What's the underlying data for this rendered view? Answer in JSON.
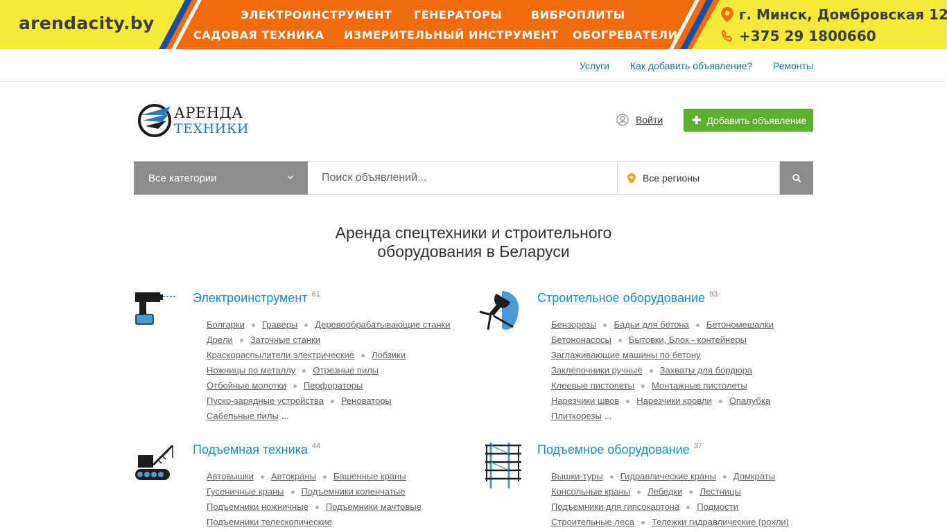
{
  "banner": {
    "brand": "arendacity.by",
    "categories": [
      "ЭЛЕКТРОИНСТРУМЕНТ",
      "ГЕНЕРАТОРЫ",
      "ВИБРОПЛИТЫ",
      "САДОВАЯ ТЕХНИКА",
      "ИЗМЕРИТЕЛЬНЫЙ ИНСТРУМЕНТ",
      "ОБОГРЕВАТЕЛИ"
    ],
    "address": "г. Минск, Домбровская 12",
    "phone": "+375 29 1800660",
    "colors": {
      "yellow": "#f5ea3a",
      "orange": "#f26a0e",
      "blue": "#1a4fa3"
    }
  },
  "top_links": [
    "Услуги",
    "Как добавить объявление?",
    "Ремонты"
  ],
  "header": {
    "logo_line1": "АРЕНДА",
    "logo_line2": "ТЕХНИКИ",
    "login_label": "Войти",
    "add_button_label": "Добавить объявление"
  },
  "search": {
    "category_value": "Все категории",
    "query_placeholder": "Поиск объявлений...",
    "region_value": "Все регионы"
  },
  "main": {
    "title_line1": "Аренда спецтехники и строительного",
    "title_line2": "оборудования в Беларуси",
    "sections": [
      {
        "name": "Электроинструмент",
        "count": "61",
        "icon": "drill-icon",
        "rows": [
          [
            "Болгарки",
            "Граверы",
            "Деревообрабатывающие станки"
          ],
          [
            "Дрели",
            "Заточные станки"
          ],
          [
            "Краскораспылители электрические",
            "Лобзики"
          ],
          [
            "Ножницы по металлу",
            "Отрезные пилы"
          ],
          [
            "Отбойные молотки",
            "Перфораторы"
          ],
          [
            "Пуско-зарядные устройства",
            "Реноваторы"
          ],
          [
            "Сабельные пилы"
          ]
        ],
        "more": "..."
      },
      {
        "name": "Строительное оборудование",
        "count": "93",
        "icon": "construction-tool-icon",
        "rows": [
          [
            "Бензорезы",
            "Бадьи для бетона",
            "Бетономешалки"
          ],
          [
            "Бетононасосы",
            "Бытовки, Блок - контейнеры"
          ],
          [
            "Заглаживающие машины по бетону"
          ],
          [
            "Заклепочники ручные",
            "Захваты для бордюра"
          ],
          [
            "Клеевые пистолеты",
            "Монтажные пистолеты"
          ],
          [
            "Нарезчики швов",
            "Нарезчики кровли",
            "Опалубка"
          ],
          [
            "Плиткорезы"
          ]
        ],
        "more": "..."
      },
      {
        "name": "Подъемная техника",
        "count": "44",
        "icon": "crawler-crane-icon",
        "rows": [
          [
            "Автовышки",
            "Автокраны",
            "Башенные краны"
          ],
          [
            "Гусеничные краны",
            "Подъемники коленчатые"
          ],
          [
            "Подъемники ножничные",
            "Подъемники мачтовые"
          ],
          [
            "Подъемники телескопические"
          ]
        ],
        "more": ""
      },
      {
        "name": "Подъемное оборудование",
        "count": "37",
        "icon": "scaffold-tower-icon",
        "rows": [
          [
            "Вышки-туры",
            "Гидравлические краны",
            "Домкраты"
          ],
          [
            "Консольные краны",
            "Лебедки",
            "Лестницы"
          ],
          [
            "Подъемники для гипсокартона",
            "Подмости"
          ],
          [
            "Строительные леса",
            "Тележки гидравлические (рохли)"
          ]
        ],
        "more": ""
      }
    ]
  }
}
